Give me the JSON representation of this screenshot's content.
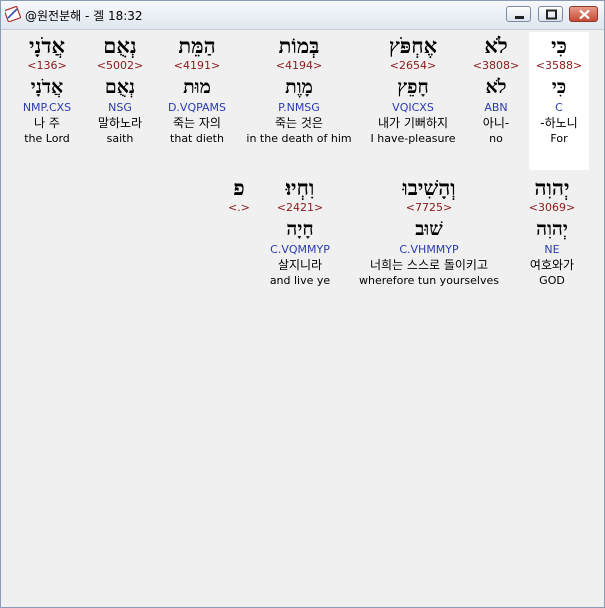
{
  "window": {
    "title": "@원전분해 - 겔 18:32"
  },
  "rows": [
    [
      {
        "heb": "כִּי",
        "num": "<3588>",
        "heb2": "כִּי",
        "parse": "C",
        "ko": "-하노니",
        "en": "For"
      },
      {
        "heb": "לֹא",
        "num": "<3808>",
        "heb2": "לֹא",
        "parse": "ABN",
        "ko": "아니-",
        "en": "no"
      },
      {
        "heb": "אֶחְפֹּץ",
        "num": "<2654>",
        "heb2": "חָפֵץ",
        "parse": "VQICXS",
        "ko": "내가 기뻐하지",
        "en": "I have-pleasure"
      },
      {
        "heb": "בְּמוֹת",
        "num": "<4194>",
        "heb2": "מָוֶת",
        "parse": "P.NMSG",
        "ko": "죽는 것은",
        "en": "in the death of him"
      },
      {
        "heb": "הַמֵּת",
        "num": "<4191>",
        "heb2": "מוּת",
        "parse": "D.VQPAMS",
        "ko": "죽는 자의",
        "en": "that dieth"
      },
      {
        "heb": "נְאֻם",
        "num": "<5002>",
        "heb2": "נְאֻם",
        "parse": "NSG",
        "ko": "말하노라",
        "en": "saith"
      },
      {
        "heb": "אֲדֹנָי",
        "num": "<136>",
        "heb2": "אֲדֹנָי",
        "parse": "NMP.CXS",
        "ko": "나 주",
        "en": "the Lord"
      }
    ],
    [
      {
        "heb": "יְהוִה",
        "num": "<3069>",
        "heb2": "יְהוִה",
        "parse": "NE",
        "ko": "여호와가",
        "en": "GOD"
      },
      {
        "heb": "וְהָשִׁיבוּ",
        "num": "<7725>",
        "heb2": "שׁוּב",
        "parse": "C.VHMMYP",
        "ko": "너희는 스스로 돌이키고",
        "en": "wherefore tun yourselves"
      },
      {
        "heb": "וִחְיוּ׃",
        "num": "<2421>",
        "heb2": "חָיָה",
        "parse": "C.VQMMYP",
        "ko": "살지니라",
        "en": "and live ye"
      },
      {
        "heb": "פ",
        "num": "<.>",
        "heb2": "",
        "parse": "",
        "ko": "",
        "en": ""
      }
    ]
  ]
}
